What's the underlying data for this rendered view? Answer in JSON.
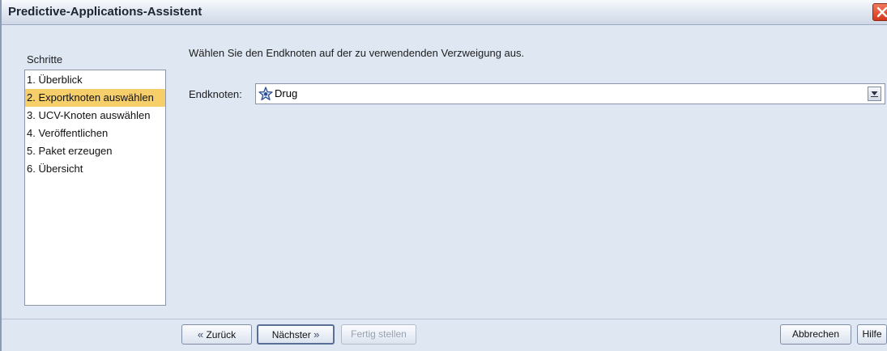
{
  "window": {
    "title": "Predictive-Applications-Assistent"
  },
  "steps": {
    "header": "Schritte",
    "items": [
      {
        "label": "1. Überblick",
        "selected": false
      },
      {
        "label": "2. Exportknoten auswählen",
        "selected": true
      },
      {
        "label": "3. UCV-Knoten auswählen",
        "selected": false
      },
      {
        "label": "4. Veröffentlichen",
        "selected": false
      },
      {
        "label": "5. Paket erzeugen",
        "selected": false
      },
      {
        "label": "6. Übersicht",
        "selected": false
      }
    ]
  },
  "main": {
    "instruction": "Wählen Sie den Endknoten auf der zu verwendenden Verzweigung aus.",
    "endnode_label": "Endknoten:",
    "endnode_value": "Drug",
    "endnode_icon": "node-star-icon"
  },
  "footer": {
    "back_label": "Zurück",
    "next_label": "Nächster",
    "finish_label": "Fertig stellen",
    "cancel_label": "Abbrechen",
    "help_label": "Hilfe"
  },
  "colors": {
    "selection": "#f6cf6b",
    "close_button": "#d4371b",
    "window_bg": "#dfe7f3"
  }
}
